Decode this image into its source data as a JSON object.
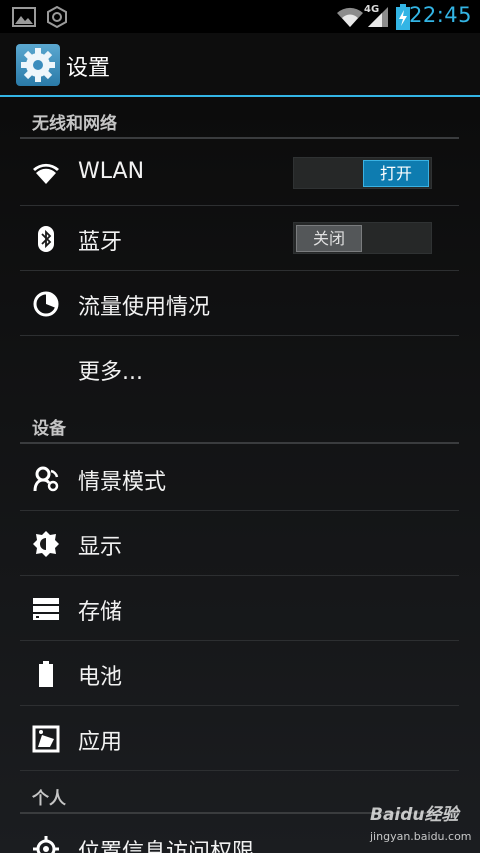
{
  "status_bar": {
    "time": "22:45",
    "network": "4G",
    "icons": [
      "gallery-icon",
      "settings-gear-status-icon",
      "wifi-signal-icon",
      "cell-signal-icon",
      "battery-charging-icon"
    ],
    "accent": "#33b5e5"
  },
  "action_bar": {
    "title": "设置",
    "icon": "settings-gear-icon"
  },
  "sections": {
    "wireless": "无线和网络",
    "device": "设备",
    "personal": "个人"
  },
  "wireless_items": {
    "wlan": {
      "label": "WLAN",
      "icon": "wifi-icon",
      "toggle": "打开"
    },
    "bluetooth": {
      "label": "蓝牙",
      "icon": "bluetooth-icon",
      "toggle": "关闭"
    },
    "data_usage": {
      "label": "流量使用情况",
      "icon": "data-usage-icon"
    },
    "more": {
      "label": "更多..."
    }
  },
  "device_items": {
    "profiles": {
      "label": "情景模式",
      "icon": "profiles-icon"
    },
    "display": {
      "label": "显示",
      "icon": "brightness-icon"
    },
    "storage": {
      "label": "存储",
      "icon": "storage-icon"
    },
    "battery": {
      "label": "电池",
      "icon": "battery-icon"
    },
    "apps": {
      "label": "应用",
      "icon": "apps-icon"
    }
  },
  "personal_items": {
    "location": {
      "label": "位置信息访问权限",
      "icon": "location-icon"
    }
  },
  "watermark": {
    "logo": "Baidu经验",
    "url": "jingyan.baidu.com"
  }
}
